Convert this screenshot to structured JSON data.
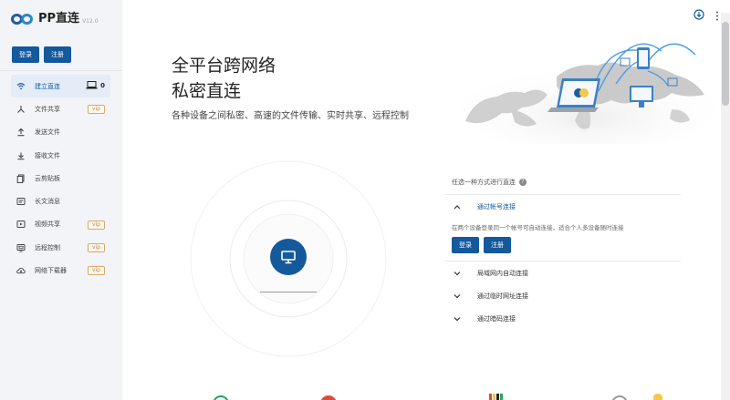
{
  "app": {
    "name": "PP直连",
    "version": "V12.0"
  },
  "sidebar": {
    "login_label": "登录",
    "register_label": "注册",
    "items": [
      {
        "label": "建立直连",
        "icon": "wifi-icon",
        "active": true,
        "device_count": "0"
      },
      {
        "label": "文件共享",
        "icon": "share-icon",
        "badge": "vip"
      },
      {
        "label": "发送文件",
        "icon": "upload-icon"
      },
      {
        "label": "接收文件",
        "icon": "download-icon"
      },
      {
        "label": "云剪贴板",
        "icon": "clipboard-icon"
      },
      {
        "label": "长文消息",
        "icon": "message-icon"
      },
      {
        "label": "视频共享",
        "icon": "video-icon",
        "badge": "vip"
      },
      {
        "label": "远程控制",
        "icon": "remote-control-icon",
        "badge": "vip"
      },
      {
        "label": "网络下载器",
        "icon": "cloud-download-icon",
        "badge": "vip"
      }
    ]
  },
  "hero": {
    "title_line1": "全平台跨网络",
    "title_line2": "私密直连",
    "subtitle": "各种设备之间私密、高速的文件传输、实时共享、远程控制"
  },
  "connect": {
    "heading": "任选一种方式进行直连",
    "options": [
      {
        "label": "通过帐号连接",
        "expanded": true,
        "description": "在两个设备登录同一个帐号可自动连接，适合个人多设备随时连接",
        "login_label": "登录",
        "register_label": "注册"
      },
      {
        "label": "局域网内自动连接",
        "expanded": false
      },
      {
        "label": "通过临时网址连接",
        "expanded": false
      },
      {
        "label": "通过暗码连接",
        "expanded": false
      }
    ]
  },
  "colors": {
    "primary": "#13599c",
    "sidebar_bg": "#f2f4f7",
    "vip": "#c08a48"
  }
}
